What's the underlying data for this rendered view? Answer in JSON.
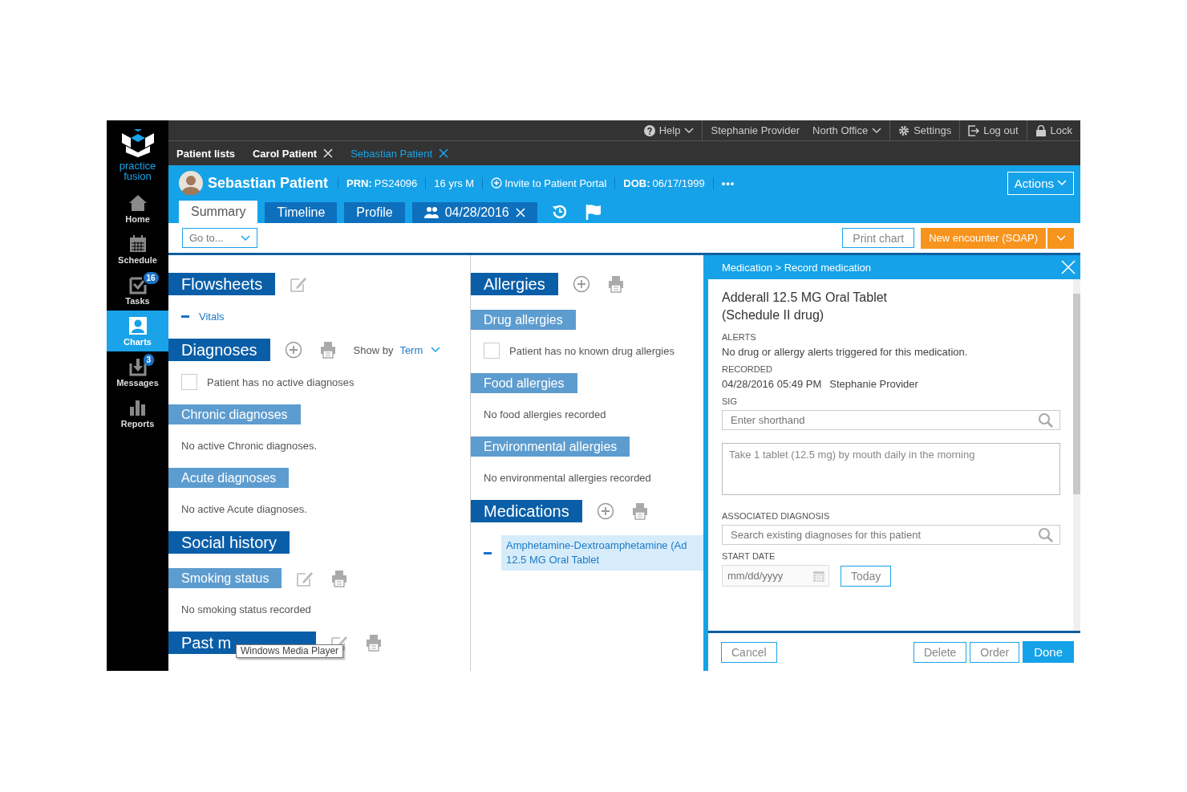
{
  "sidebar": {
    "logo": "practice fusion",
    "items": [
      {
        "kind": "home",
        "label": "Home",
        "selected": false
      },
      {
        "kind": "calendar",
        "label": "Schedule",
        "selected": false
      },
      {
        "kind": "tasks",
        "label": "Tasks",
        "badge": "16",
        "selected": false
      },
      {
        "kind": "charts",
        "label": "Charts",
        "selected": true
      },
      {
        "kind": "messages",
        "label": "Messages",
        "badge": "3",
        "selected": false
      },
      {
        "kind": "reports",
        "label": "Reports",
        "selected": false
      }
    ]
  },
  "top_bar": {
    "help": "Help",
    "user": "Stephanie Provider",
    "office": "North Office",
    "settings": "Settings",
    "logout": "Log out",
    "lock": "Lock"
  },
  "patient_tabs": [
    {
      "label": "Patient lists",
      "closable": false,
      "selected": false
    },
    {
      "label": "Carol Patient",
      "closable": true,
      "selected": false
    },
    {
      "label": "Sebastian Patient",
      "closable": true,
      "selected": true
    }
  ],
  "patient": {
    "name": "Sebastian Patient",
    "prn_label": "PRN:",
    "prn": "PS24096",
    "age": "16 yrs M",
    "invite": "Invite to Patient Portal",
    "dob_label": "DOB:",
    "dob": "06/17/1999",
    "more": "•••",
    "actions": "Actions"
  },
  "chart_tabs": [
    {
      "kind": "plain",
      "label": "Summary",
      "selected": true
    },
    {
      "kind": "plain",
      "label": "Timeline",
      "selected": false
    },
    {
      "kind": "plain",
      "label": "Profile",
      "selected": false
    },
    {
      "kind": "encounter",
      "label": "04/28/2016",
      "selected": false
    }
  ],
  "toolbar": {
    "goto": "Go to...",
    "print": "Print chart",
    "new_encounter": "New encounter (SOAP)"
  },
  "left_sections": [
    {
      "title": "Flowsheets",
      "kind": "main",
      "tools": [
        {
          "kind": "edit"
        }
      ],
      "content": [
        {
          "kind": "link",
          "text": "Vitals"
        }
      ]
    },
    {
      "title": "Diagnoses",
      "kind": "main",
      "tools": [
        {
          "kind": "add"
        },
        {
          "kind": "print"
        }
      ],
      "show_by": {
        "label": "Show by",
        "value": "Term"
      },
      "content": [
        {
          "kind": "checkbox",
          "text": "Patient has no active diagnoses",
          "checked": false
        }
      ]
    },
    {
      "title": "Chronic diagnoses",
      "kind": "sub",
      "content": [
        {
          "kind": "text",
          "text": "No active Chronic diagnoses."
        }
      ]
    },
    {
      "title": "Acute diagnoses",
      "kind": "sub",
      "content": [
        {
          "kind": "text",
          "text": "No active Acute diagnoses."
        }
      ]
    },
    {
      "title": "Social history",
      "kind": "main"
    },
    {
      "title": "Smoking status",
      "kind": "sub",
      "tools": [
        {
          "kind": "edit"
        },
        {
          "kind": "print"
        }
      ],
      "content": [
        {
          "kind": "text",
          "text": "No smoking status recorded"
        }
      ]
    },
    {
      "title": "Past m",
      "kind": "main",
      "tools": [
        {
          "kind": "edit"
        },
        {
          "kind": "print"
        }
      ],
      "tooltip": "Windows Media Player"
    }
  ],
  "middle_sections": [
    {
      "title": "Allergies",
      "kind": "main",
      "tools": [
        {
          "kind": "add"
        },
        {
          "kind": "print"
        }
      ]
    },
    {
      "title": "Drug allergies",
      "kind": "sub",
      "content": [
        {
          "kind": "checkbox",
          "text": "Patient has no known drug allergies",
          "checked": false
        }
      ]
    },
    {
      "title": "Food allergies",
      "kind": "sub",
      "content": [
        {
          "kind": "text",
          "text": "No food allergies recorded"
        }
      ]
    },
    {
      "title": "Environmental allergies",
      "kind": "sub",
      "content": [
        {
          "kind": "text",
          "text": "No environmental allergies recorded"
        }
      ]
    },
    {
      "title": "Medications",
      "kind": "main",
      "tools": [
        {
          "kind": "add"
        },
        {
          "kind": "print"
        }
      ],
      "content": [
        {
          "kind": "medication",
          "lines": [
            "Amphetamine-Dextroamphetamine (Ad",
            "12.5 MG Oral Tablet"
          ]
        }
      ]
    }
  ],
  "panel": {
    "breadcrumb": "Medication > Record medication",
    "drug": [
      "Adderall 12.5 MG Oral Tablet",
      "(Schedule II drug)"
    ],
    "alerts_label": "ALERTS",
    "alerts": "No drug or allergy alerts triggered for this medication.",
    "recorded_label": "RECORDED",
    "recorded_time": "04/28/2016 05:49 PM",
    "recorded_by": "Stephanie Provider",
    "sig_label": "SIG",
    "sig_placeholder": "Enter shorthand",
    "sig_text": "Take 1 tablet (12.5 mg) by mouth daily in the morning",
    "diagnosis_label": "ASSOCIATED DIAGNOSIS",
    "diagnosis_placeholder": "Search existing diagnoses for this patient",
    "start_label": "START DATE",
    "start_placeholder": "mm/dd/yyyy",
    "today": "Today",
    "cancel": "Cancel",
    "delete": "Delete",
    "order": "Order",
    "done": "Done"
  }
}
